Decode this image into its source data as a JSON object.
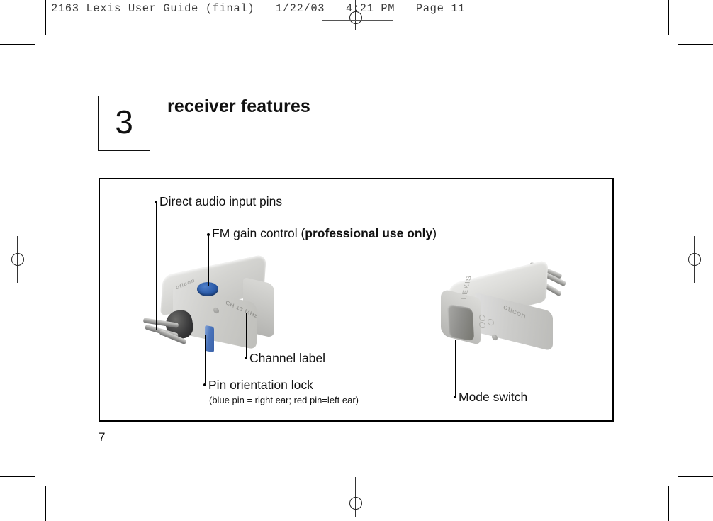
{
  "prepress": {
    "header_text": "2163 Lexis User Guide (final)   1/22/03   4:21 PM   Page 11",
    "registration_marks": [
      "top-center",
      "bottom-center",
      "left-middle",
      "right-middle"
    ],
    "crop_marks": [
      "top-left",
      "top-right",
      "bottom-left",
      "bottom-right"
    ]
  },
  "chapter": {
    "number": "3",
    "title": "receiver features"
  },
  "figure": {
    "callouts": [
      {
        "id": "direct-audio-input-pins",
        "text": "Direct audio input pins",
        "sub": ""
      },
      {
        "id": "fm-gain-control",
        "text_before": "FM gain control (",
        "text_bold": "professional use only",
        "text_after": ")"
      },
      {
        "id": "channel-label",
        "text": "Channel label",
        "sub": ""
      },
      {
        "id": "pin-orientation-lock",
        "text": "Pin orientation lock",
        "sub": "(blue pin = right ear; red pin=left ear)"
      },
      {
        "id": "mode-switch",
        "text": "Mode switch",
        "sub": ""
      }
    ],
    "devices": [
      {
        "id": "receiver-front-view",
        "brand": "oticon",
        "channel_marking": "CH  13  MHz",
        "accent_color": "#2a5aa8"
      },
      {
        "id": "receiver-rear-view",
        "brand": "oticon",
        "model": "LEXIS"
      }
    ]
  },
  "page": {
    "number": "7"
  }
}
